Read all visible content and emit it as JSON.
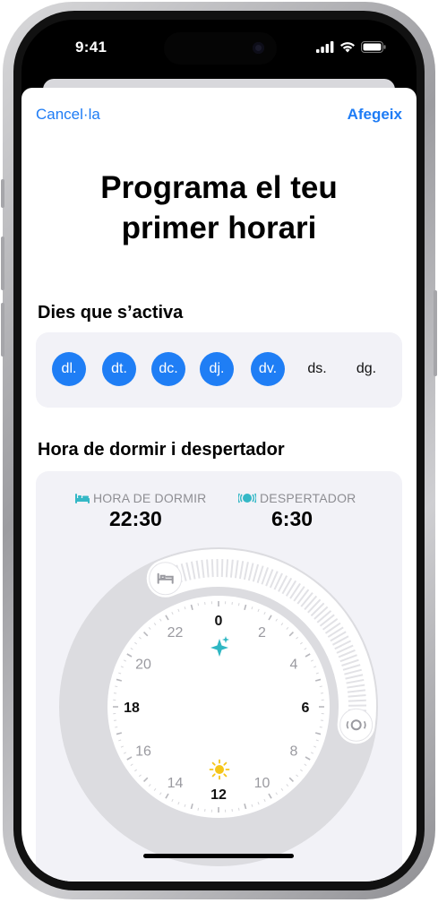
{
  "status_bar": {
    "time": "9:41"
  },
  "nav": {
    "cancel_label": "Cancel·la",
    "add_label": "Afegeix"
  },
  "title": {
    "line1": "Programa el teu",
    "line2": "primer horari"
  },
  "days_section": {
    "label": "Dies que s’activa",
    "days": [
      {
        "label": "dl.",
        "active": true
      },
      {
        "label": "dt.",
        "active": true
      },
      {
        "label": "dc.",
        "active": true
      },
      {
        "label": "dj.",
        "active": true
      },
      {
        "label": "dv.",
        "active": true
      },
      {
        "label": "ds.",
        "active": false
      },
      {
        "label": "dg.",
        "active": false
      }
    ]
  },
  "schedule_section": {
    "label": "Hora de dormir i despertador",
    "bedtime": {
      "label": "HORA DE DORMIR",
      "value": "22:30",
      "icon": "bed-icon"
    },
    "wakeup": {
      "label": "DESPERTADOR",
      "value": "6:30",
      "icon": "alarm-icon"
    },
    "clock_numbers": [
      "0",
      "2",
      "4",
      "6",
      "8",
      "10",
      "12",
      "14",
      "16",
      "18",
      "20",
      "22"
    ],
    "bold_numbers": [
      "0",
      "6",
      "12",
      "18"
    ],
    "bedtime_hour": 22.5,
    "wakeup_hour": 6.5
  },
  "colors": {
    "accent": "#1f7ef5",
    "bedtime_icon": "#35b8c6",
    "sparkle": "#2fb7c3",
    "sun": "#f5c518"
  }
}
